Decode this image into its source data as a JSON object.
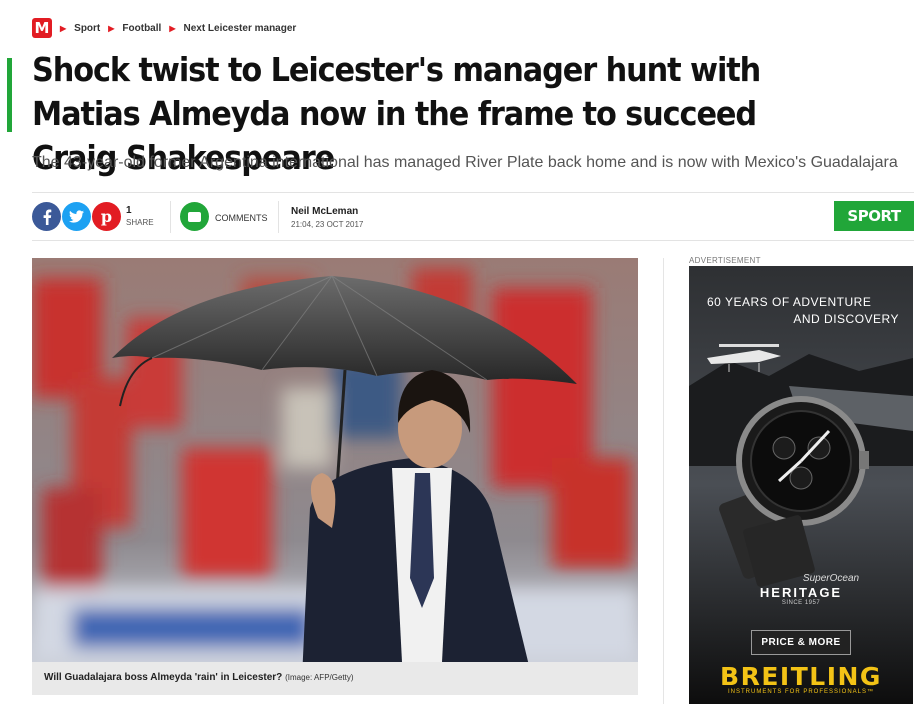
{
  "breadcrumb": {
    "logo": "M",
    "items": [
      "Sport",
      "Football",
      "Next Leicester manager"
    ]
  },
  "article": {
    "headline": "Shock twist to Leicester's manager hunt with Matias Almeyda now in the frame to succeed Craig Shakespeare",
    "standfirst": "The 43-year-old former Argentina international has managed River Plate back home and is now with Mexico's Guadalajara",
    "author": "Neil McLeman",
    "date": "21:04, 23 OCT 2017",
    "section": "SPORT"
  },
  "share": {
    "count": "1",
    "label": "SHARE",
    "comments_label": "COMMENTS",
    "icons": [
      "facebook-icon",
      "twitter-icon",
      "pinterest-icon",
      "comments-icon"
    ]
  },
  "image": {
    "caption": "Will Guadalajara boss Almeyda 'rain' in Leicester?",
    "credit": "(Image: AFP/Getty)"
  },
  "advert": {
    "label": "ADVERTISEMENT",
    "line1": "60 YEARS OF ADVENTURE",
    "line2": "AND DISCOVERY",
    "model_script": "SuperOcean",
    "model": "HERITAGE",
    "since": "SINCE 1957",
    "button": "PRICE & MORE",
    "brand": "BREITLING",
    "tagline": "INSTRUMENTS FOR PROFESSIONALS™"
  },
  "colors": {
    "brand_red": "#e21c23",
    "sport_green": "#21a639",
    "facebook": "#3b5998",
    "twitter": "#1da1f2",
    "breitling_gold": "#f3c316"
  }
}
